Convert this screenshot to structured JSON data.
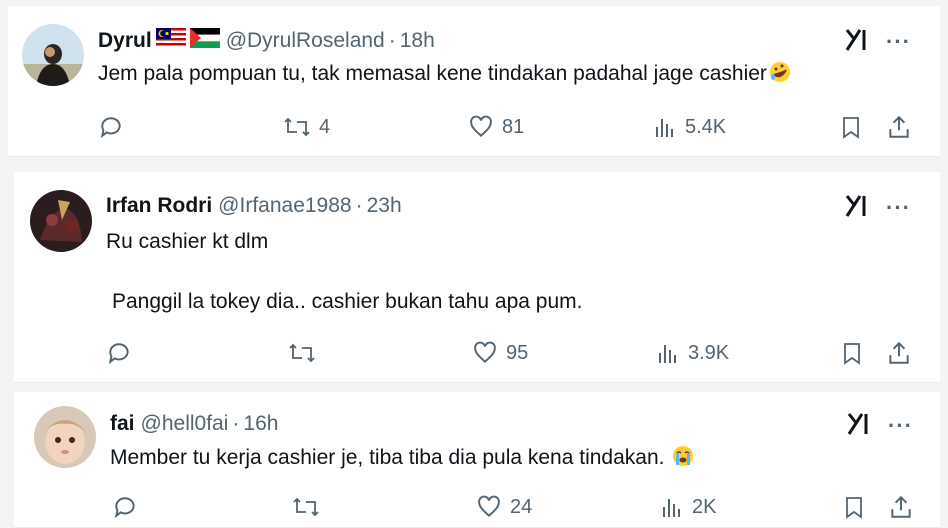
{
  "replies": [
    {
      "name": "Dyrul",
      "handle": "@DyrulRoseland",
      "separator": "·",
      "time": "18h",
      "lines": [
        "Jem pala pompuan tu, tak memasal kene tindakan padahal jage cashier"
      ],
      "emoji": "rolling-laughing-emoji",
      "retweets": "4",
      "likes": "81",
      "views": "5.4K"
    },
    {
      "name": "Irfan Rodri",
      "handle": "@Irfanae1988",
      "separator": "·",
      "time": "23h",
      "lines": [
        "Ru cashier kt dlm",
        "Panggil la tokey dia.. cashier bukan tahu apa pum."
      ],
      "emoji": "",
      "retweets": "",
      "likes": "95",
      "views": "3.9K"
    },
    {
      "name": "fai",
      "handle": "@hell0fai",
      "separator": "·",
      "time": "16h",
      "lines": [
        "Member tu kerja cashier je, tiba tiba dia pula kena tindakan."
      ],
      "emoji": "crying-face-emoji",
      "retweets": "",
      "likes": "24",
      "views": "2K"
    }
  ],
  "more_label": "···",
  "colors": {
    "text": "#0f1419",
    "muted": "#536471",
    "background": "#ffffff"
  }
}
